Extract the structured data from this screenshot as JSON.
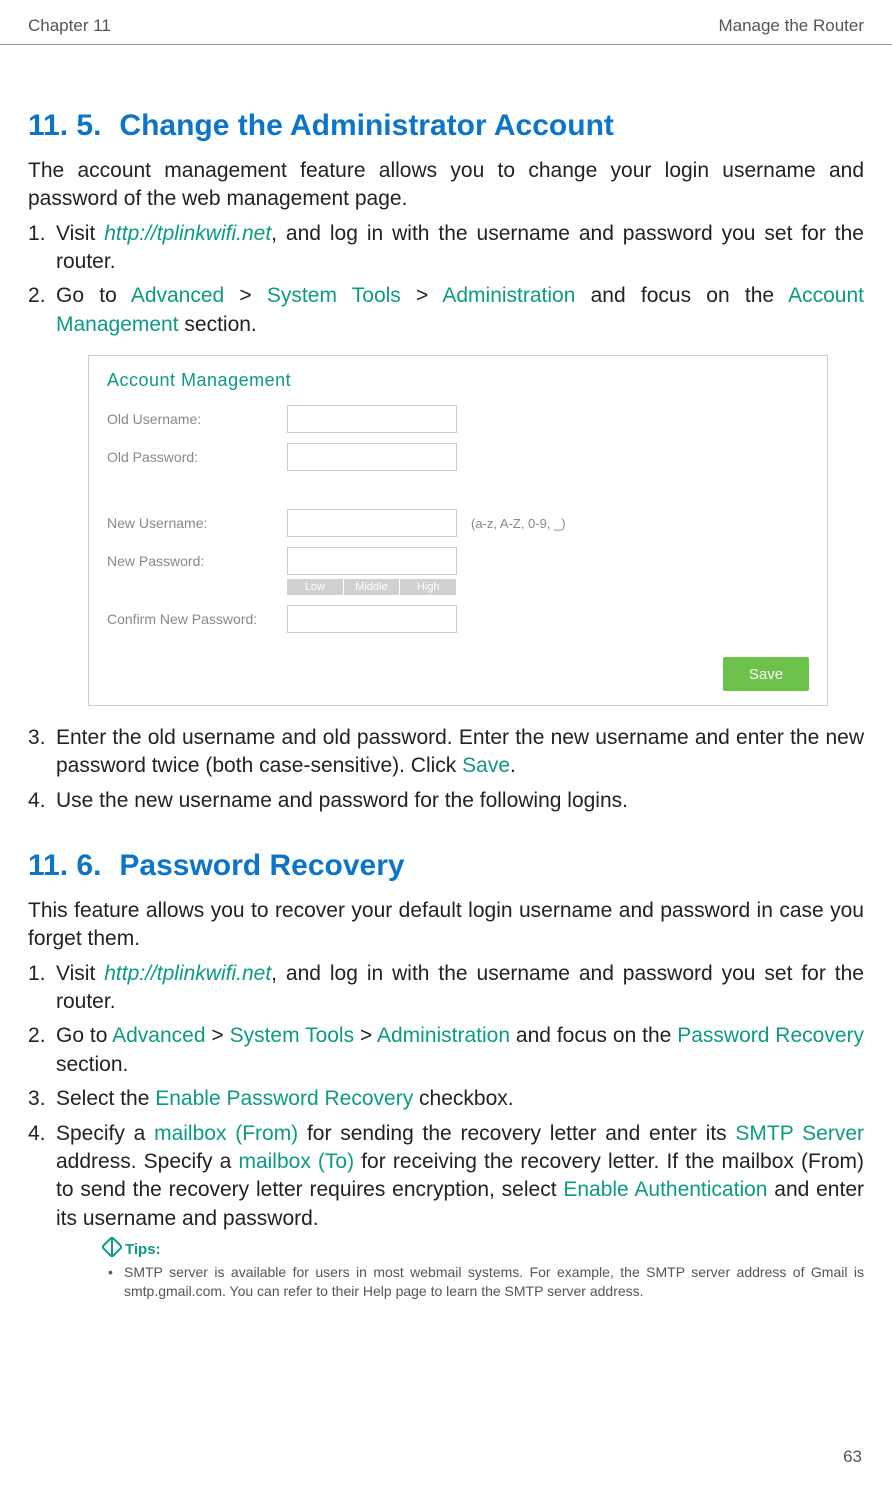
{
  "header": {
    "left": "Chapter 11",
    "right": "Manage the Router"
  },
  "section1": {
    "number": "11. 5.",
    "title": "Change the Administrator Account",
    "intro": "The account management feature allows you to change your login username and password of the web management page.",
    "step1_pre": "Visit ",
    "step1_link": "http://tplinkwifi.net",
    "step1_post": ", and log in with the username and password you set for the router.",
    "step2_pre": "Go to ",
    "step2_t1": "Advanced",
    "step2_gt": " > ",
    "step2_t2": "System Tools",
    "step2_t3": "Administration",
    "step2_mid": " and focus on the ",
    "step2_t4": "Account Management",
    "step2_post": " section.",
    "step3_pre": "Enter the old username and old password. Enter the new username and enter the new password twice (both case-sensitive). Click ",
    "step3_t1": "Save",
    "step3_post": ".",
    "step4": "Use the new username and password for the following  logins."
  },
  "screenshot": {
    "title": "Account Management",
    "old_username": "Old Username:",
    "old_password": "Old Password:",
    "new_username": "New Username:",
    "new_username_hint": "(a-z, A-Z, 0-9, _)",
    "new_password": "New Password:",
    "strength_low": "Low",
    "strength_mid": "Middle",
    "strength_high": "High",
    "confirm_password": "Confirm New Password:",
    "save": "Save"
  },
  "section2": {
    "number": "11. 6.",
    "title": "Password Recovery",
    "intro": "This feature allows you to recover your default login username and password in case you forget them.",
    "step1_pre": "Visit ",
    "step1_link": "http://tplinkwifi.net",
    "step1_post": ", and log in with the username and password you set for the router.",
    "step2_pre": "Go to ",
    "step2_t1": "Advanced",
    "step2_gt": " > ",
    "step2_t2": "System Tools",
    "step2_t3": "Administration",
    "step2_mid": " and focus on the ",
    "step2_t4": "Password Recovery",
    "step2_post": " section.",
    "step3_pre": "Select the ",
    "step3_t1": "Enable Password Recovery",
    "step3_post": " checkbox.",
    "step4_pre": "Specify a ",
    "step4_t1": "mailbox (From)",
    "step4_mid1": " for sending the recovery letter and enter its ",
    "step4_t2": "SMTP Server",
    "step4_mid2": " address. Specify a ",
    "step4_t3": "mailbox (To)",
    "step4_mid3": " for receiving the recovery letter. If the mailbox (From) to send the recovery letter requires encryption, select ",
    "step4_t4": "Enable Authentication",
    "step4_post": " and enter its username and password."
  },
  "tips": {
    "heading": "Tips:",
    "tip1": "SMTP server is available for users in most webmail systems. For example, the SMTP server address of Gmail is smtp.gmail.com. You can refer to their Help page to learn the SMTP server address."
  },
  "page_number": "63"
}
